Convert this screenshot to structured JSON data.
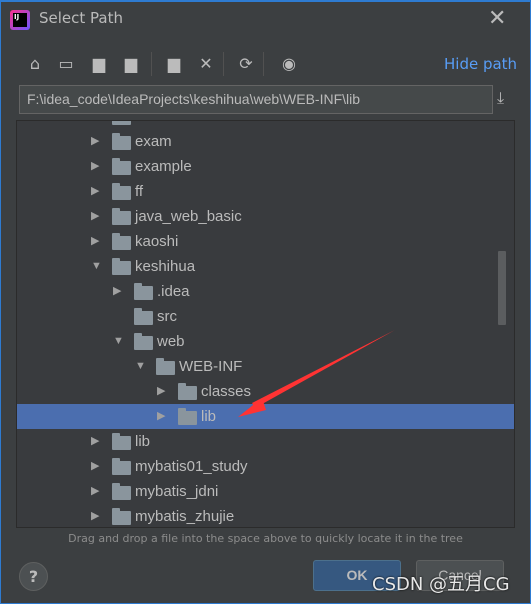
{
  "window": {
    "title": "Select Path",
    "close_icon": "close-icon"
  },
  "toolbar": {
    "icons": [
      "home-icon",
      "desktop-icon",
      "project-folder-icon",
      "module-folder-icon",
      "new-folder-icon",
      "delete-icon",
      "refresh-icon",
      "show-hidden-icon"
    ],
    "hide_path": "Hide path"
  },
  "path": {
    "value": "F:\\idea_code\\IdeaProjects\\keshihua\\web\\WEB-INF\\lib"
  },
  "tree": {
    "rows": [
      {
        "label": "",
        "level": 0,
        "toggle": "right"
      },
      {
        "label": "exam",
        "level": 0,
        "toggle": "right"
      },
      {
        "label": "example",
        "level": 0,
        "toggle": "right"
      },
      {
        "label": "ff",
        "level": 0,
        "toggle": "right"
      },
      {
        "label": "java_web_basic",
        "level": 0,
        "toggle": "right"
      },
      {
        "label": "kaoshi",
        "level": 0,
        "toggle": "right"
      },
      {
        "label": "keshihua",
        "level": 0,
        "toggle": "down"
      },
      {
        "label": ".idea",
        "level": 1,
        "toggle": "right"
      },
      {
        "label": "src",
        "level": 1,
        "toggle": "none"
      },
      {
        "label": "web",
        "level": 1,
        "toggle": "down"
      },
      {
        "label": "WEB-INF",
        "level": 2,
        "toggle": "down"
      },
      {
        "label": "classes",
        "level": 3,
        "toggle": "right"
      },
      {
        "label": "lib",
        "level": 3,
        "toggle": "right",
        "selected": true
      },
      {
        "label": "lib",
        "level": 0,
        "toggle": "right"
      },
      {
        "label": "mybatis01_study",
        "level": 0,
        "toggle": "right"
      },
      {
        "label": "mybatis_jdni",
        "level": 0,
        "toggle": "right"
      },
      {
        "label": "mybatis_zhujie",
        "level": 0,
        "toggle": "right"
      }
    ]
  },
  "hint": "Drag and drop a file into the space above to quickly locate it in the tree",
  "buttons": {
    "help": "?",
    "ok": "OK",
    "cancel": "Cancel"
  },
  "watermark": "CSDN @五月CG",
  "colors": {
    "selection": "#4b6eaf",
    "link": "#589df6",
    "annotation_arrow": "#ff3333"
  }
}
